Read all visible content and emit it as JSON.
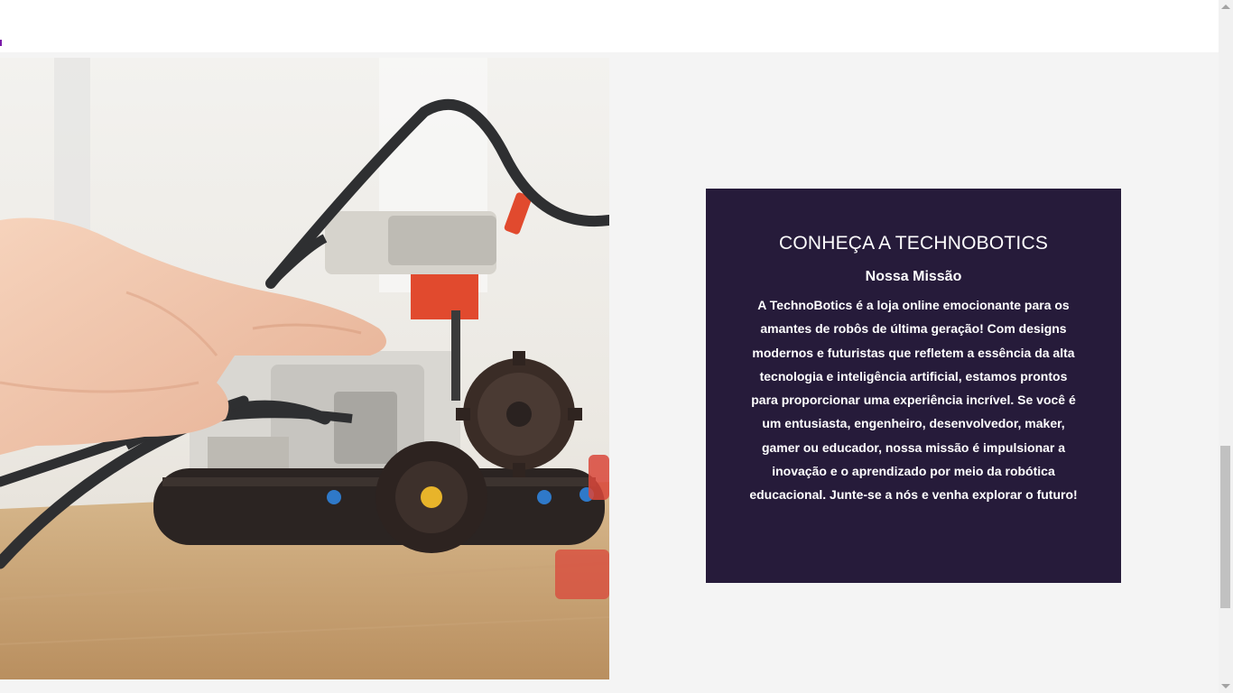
{
  "about": {
    "title": "CONHEÇA A TECHNOBOTICS",
    "subtitle": "Nossa Missão",
    "body": "A TechnoBotics é a loja online emocionante para os amantes de robôs de última geração! Com designs modernos e futuristas que refletem a essência da alta tecnologia e inteligência artificial, estamos prontos para proporcionar uma experiência incrível. Se você é um entusiasta, engenheiro, desenvolvedor, maker, gamer ou educador, nossa missão é impulsionar a inovação e o aprendizado por meio da robótica educacional. Junte-se a nós e venha explorar o futuro!"
  },
  "colors": {
    "card_background": "#261b3a",
    "page_background": "#f4f4f4"
  }
}
